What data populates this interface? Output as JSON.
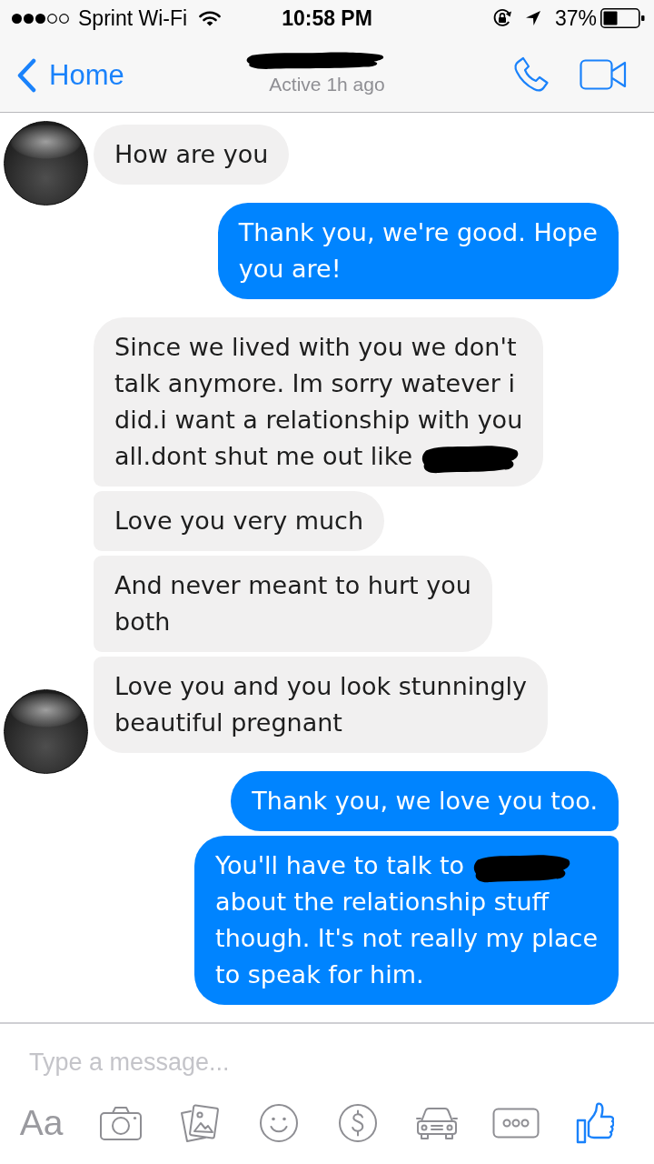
{
  "status_bar": {
    "carrier": "Sprint Wi-Fi",
    "time": "10:58 PM",
    "battery": "37%"
  },
  "header": {
    "back_label": "Home",
    "title_redacted": true,
    "status": "Active 1h ago"
  },
  "messages": [
    {
      "kind": "received",
      "avatar": true,
      "segments": [
        {
          "kind": "text",
          "text": "How are you"
        }
      ]
    },
    {
      "kind": "sent",
      "avatar": false,
      "segments": [
        {
          "kind": "text",
          "text": "Thank you, we're good. Hope\nyou are!"
        }
      ]
    },
    {
      "kind": "received",
      "avatar": false,
      "segments": [
        {
          "kind": "text",
          "text": "Since we lived with you we don't\ntalk anymore. Im sorry watever i\ndid.i want a relationship with you\nall.dont shut me out like"
        },
        {
          "kind": "redaction"
        }
      ]
    },
    {
      "kind": "received",
      "avatar": false,
      "segments": [
        {
          "kind": "text",
          "text": "Love you very much"
        }
      ]
    },
    {
      "kind": "received",
      "avatar": false,
      "segments": [
        {
          "kind": "text",
          "text": "And never meant to hurt you\nboth"
        }
      ]
    },
    {
      "kind": "received",
      "avatar": true,
      "segments": [
        {
          "kind": "text",
          "text": "Love you and you look stunningly\nbeautiful pregnant"
        }
      ]
    },
    {
      "kind": "sent",
      "avatar": false,
      "segments": [
        {
          "kind": "text",
          "text": "Thank you, we love you too."
        }
      ]
    },
    {
      "kind": "sent",
      "avatar": false,
      "segments": [
        {
          "kind": "text",
          "text": "You'll have to talk to"
        },
        {
          "kind": "redaction"
        },
        {
          "kind": "text",
          "text": "\nabout the relationship stuff\nthough. It's not really my place\nto speak for him."
        }
      ]
    }
  ],
  "composer": {
    "placeholder": "Type a message...",
    "font_button": "Aa"
  }
}
